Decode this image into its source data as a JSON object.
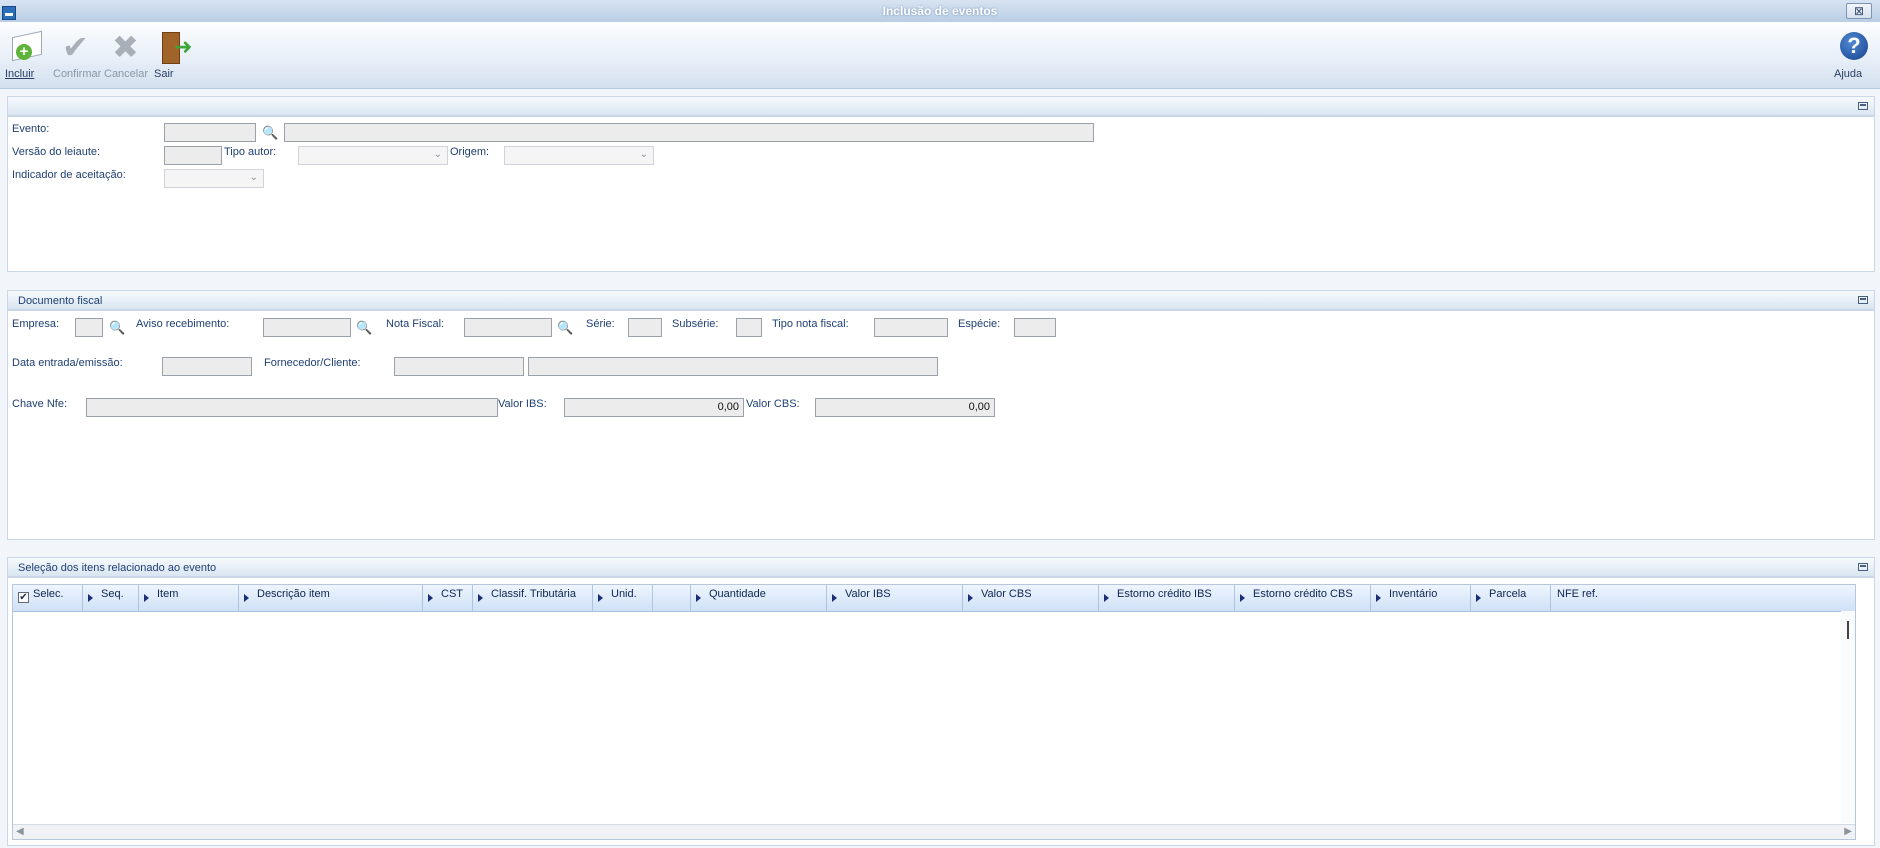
{
  "window": {
    "title": "Inclusão de eventos",
    "close_symbol": "⊠"
  },
  "toolbar": {
    "incluir": "Incluir",
    "confirmar": "Confirmar",
    "cancelar": "Cancelar",
    "sair": "Sair",
    "ajuda": "Ajuda"
  },
  "evento_panel": {
    "evento_label": "Evento:",
    "versao_label": "Versão do leiaute:",
    "tipo_autor_label": "Tipo autor:",
    "origem_label": "Origem:",
    "indicador_label": "Indicador de aceitação:",
    "evento_code": "",
    "evento_desc": "",
    "versao": ""
  },
  "documento_panel": {
    "title": "Documento fiscal",
    "empresa_label": "Empresa:",
    "aviso_label": "Aviso recebimento:",
    "nota_label": "Nota Fiscal:",
    "serie_label": "Série:",
    "subserie_label": "Subsérie:",
    "tipo_nota_label": "Tipo nota fiscal:",
    "especie_label": "Espécie:",
    "data_label": "Data entrada/emissão:",
    "fornecedor_label": "Fornecedor/Cliente:",
    "chave_label": "Chave Nfe:",
    "valor_ibs_label": "Valor IBS:",
    "valor_cbs_label": "Valor CBS:",
    "valor_ibs": "0,00",
    "valor_cbs": "0,00"
  },
  "itens_panel": {
    "title": "Seleção dos itens relacionado ao evento",
    "columns": [
      "Selec.",
      "Seq.",
      "Item",
      "Descrição item",
      "CST",
      "Classif. Tributária",
      "Unid.",
      "",
      "Quantidade",
      "Valor IBS",
      "Valor CBS",
      "Estorno crédito IBS",
      "Estorno crédito CBS",
      "Inventário",
      "Parcela",
      "NFE ref."
    ],
    "select_all_mark": "✔"
  },
  "icons": [
    "incluir-icon",
    "confirmar-icon",
    "cancelar-icon",
    "sair-icon",
    "ajuda-icon",
    "lookup-icon",
    "chevron-down-icon"
  ]
}
